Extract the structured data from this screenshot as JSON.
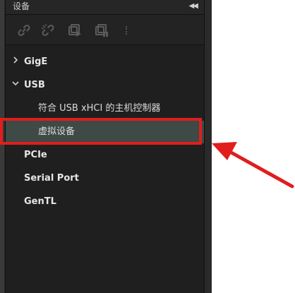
{
  "panel": {
    "title": "设备",
    "collapse_icon": "double-left-arrow-icon"
  },
  "toolbar": {
    "buttons": [
      {
        "name": "connect-icon"
      },
      {
        "name": "disconnect-icon"
      },
      {
        "name": "single-capture-icon"
      },
      {
        "name": "stop-capture-icon"
      }
    ]
  },
  "tree": {
    "items": [
      {
        "label": "GigE",
        "expanded": false
      },
      {
        "label": "USB",
        "expanded": true
      },
      {
        "label": "符合 USB xHCI 的主机控制器"
      },
      {
        "label": "虚拟设备",
        "selected": true
      },
      {
        "label": "PCIe"
      },
      {
        "label": "Serial Port"
      },
      {
        "label": "GenTL"
      }
    ]
  },
  "annotation": {
    "highlight_color": "#e11d1d"
  }
}
